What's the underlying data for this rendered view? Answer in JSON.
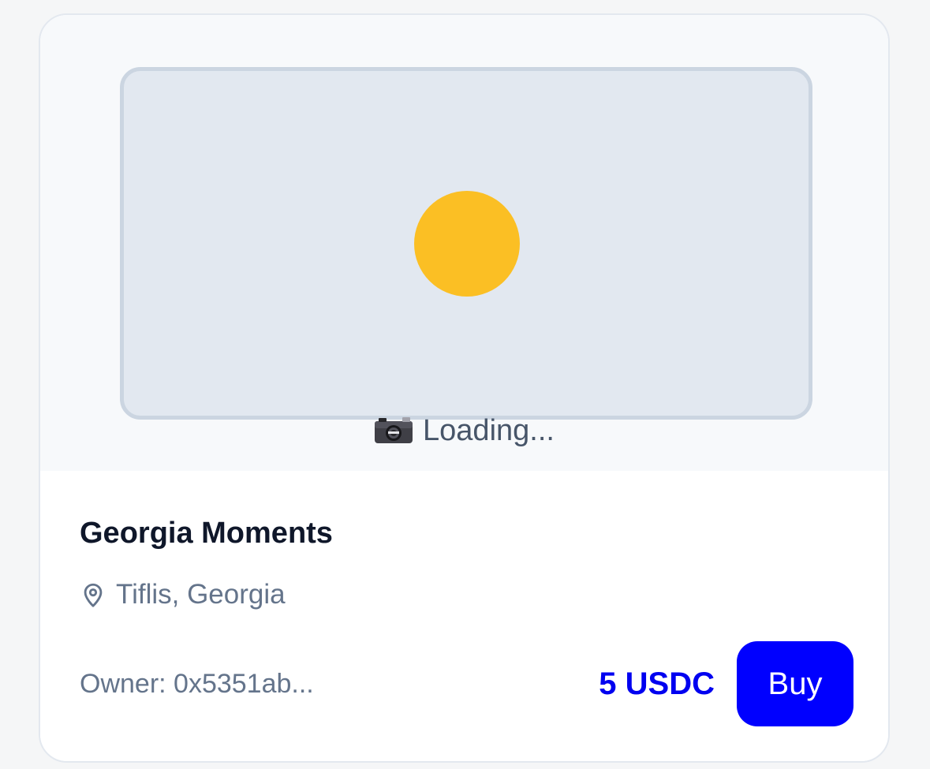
{
  "card": {
    "media": {
      "loading_text": "Loading...",
      "loading_icon": "camera-icon",
      "placeholder_colors": {
        "frame_fill": "#e2e8f0",
        "frame_border": "#cbd5e1",
        "sun": "#fbbf24"
      }
    },
    "title": "Georgia Moments",
    "location": {
      "icon": "map-pin-icon",
      "text": "Tiflis, Georgia"
    },
    "owner": "Owner: 0x5351ab...",
    "price": "5 USDC",
    "buy_label": "Buy",
    "colors": {
      "accent": "#0000ff",
      "muted_text": "#64748b",
      "title_text": "#0f172a"
    }
  }
}
